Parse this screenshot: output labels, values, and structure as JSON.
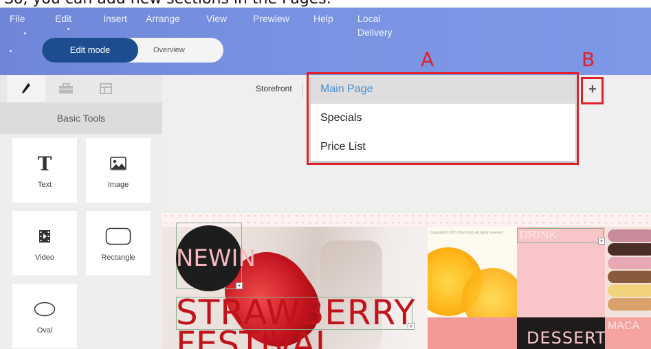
{
  "caption_text": "So, you can add new sections in the Pages.",
  "menu": {
    "items": [
      "File",
      "Edit",
      "Insert",
      "Arrange",
      "View",
      "Prewiew",
      "Help",
      "Local Delivery"
    ]
  },
  "mode_toggle": {
    "edit_label": "Edit mode",
    "overview_label": "Overview",
    "active": "edit"
  },
  "tools_panel": {
    "tabs": [
      "pencil-icon",
      "toolbox-icon",
      "layout-icon"
    ],
    "title": "Basic Tools",
    "tools": [
      {
        "label": "Text",
        "icon": "text-icon"
      },
      {
        "label": "Image",
        "icon": "image-icon"
      },
      {
        "label": "Video",
        "icon": "video-icon"
      },
      {
        "label": "Rectangle",
        "icon": "rectangle-icon"
      },
      {
        "label": "Oval",
        "icon": "oval-icon"
      }
    ]
  },
  "page_tabs": {
    "storefront_label": "Storefront",
    "pages": [
      {
        "label": "Main Page",
        "selected": true
      },
      {
        "label": "Specials",
        "selected": false
      },
      {
        "label": "Price List",
        "selected": false
      }
    ],
    "add_label": "+"
  },
  "annotations": {
    "a": "A",
    "b": "B",
    "color": "#e0202a"
  },
  "preview": {
    "badge": "NEWIN",
    "headline": "STRAWBERRY",
    "subline": "FESTIVAL",
    "copyright": "Copyright © 2015 Best Corp. All rights reserved.",
    "drink": "DRINK",
    "dessert": "DESSERT",
    "maca": "MACA"
  },
  "colors": {
    "header": "#7a93e2",
    "edit_mode": "#1e4d8f",
    "selected_page": "#3f8fd6",
    "headline": "#c1121c"
  }
}
